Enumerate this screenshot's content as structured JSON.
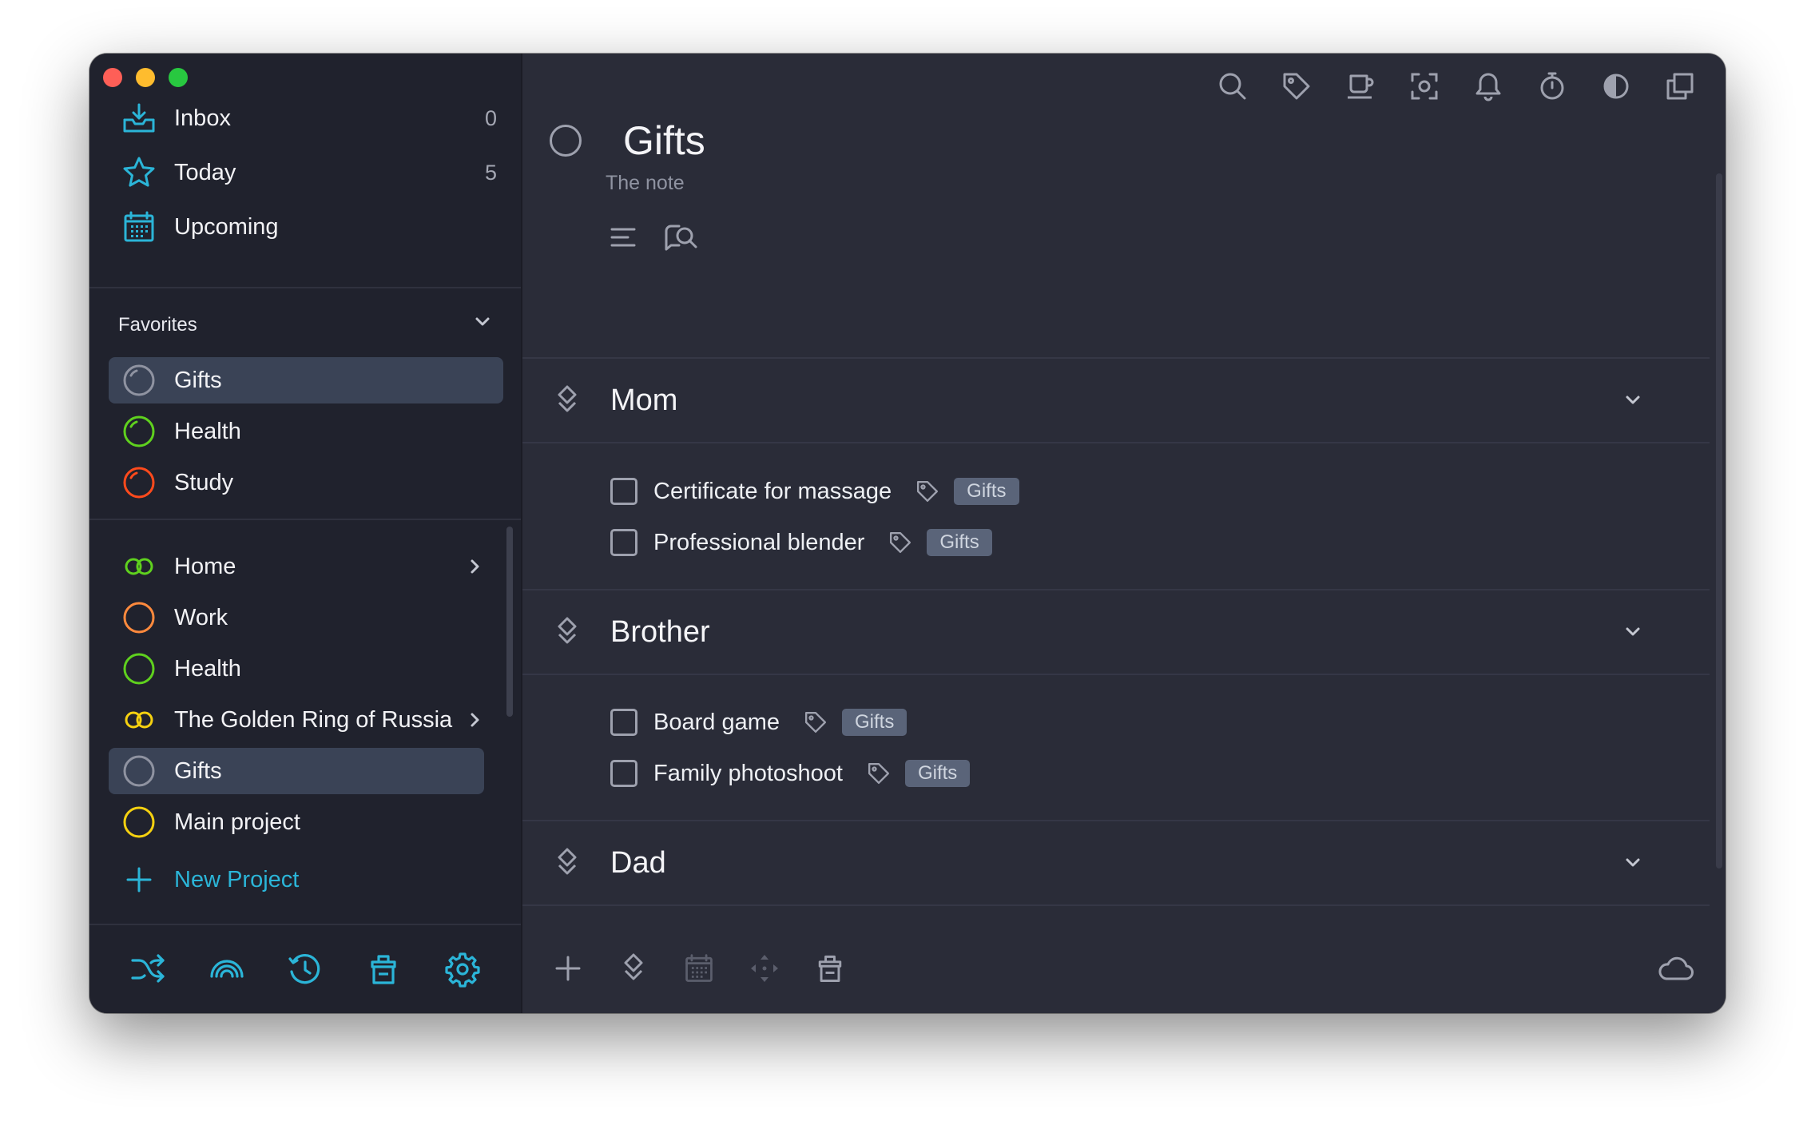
{
  "sidebar": {
    "nav": [
      {
        "label": "Inbox",
        "count": "0",
        "icon": "inbox-icon"
      },
      {
        "label": "Today",
        "count": "5",
        "icon": "star-icon"
      },
      {
        "label": "Upcoming",
        "count": "",
        "icon": "calendar-icon"
      }
    ],
    "favorites_label": "Favorites",
    "favorites": [
      {
        "label": "Gifts",
        "color": "#8f93a1"
      },
      {
        "label": "Health",
        "color": "#5fd11e"
      },
      {
        "label": "Study",
        "color": "#ff4a1c"
      }
    ],
    "projects": [
      {
        "label": "Home",
        "color": "#5fd11e",
        "icon": "double-ring-icon",
        "has_children": true
      },
      {
        "label": "Work",
        "color": "#ff8a3d",
        "icon": "ring-icon"
      },
      {
        "label": "Health",
        "color": "#5fd11e",
        "icon": "ring-icon"
      },
      {
        "label": "The Golden Ring of Russia",
        "color": "#f5d110",
        "icon": "double-ring-icon",
        "has_children": true
      },
      {
        "label": "Gifts",
        "color": "#8f93a1",
        "icon": "ring-icon"
      },
      {
        "label": "Main project",
        "color": "#f5d110",
        "icon": "ring-icon"
      }
    ],
    "new_project_label": "New Project",
    "accent": "#2bb5d8"
  },
  "main": {
    "title": "Gifts",
    "note": "The note",
    "sections": [
      {
        "title": "Mom",
        "tasks": [
          {
            "name": "Certificate for massage",
            "tag": "Gifts"
          },
          {
            "name": "Professional blender",
            "tag": "Gifts"
          }
        ]
      },
      {
        "title": "Brother",
        "tasks": [
          {
            "name": "Board game",
            "tag": "Gifts"
          },
          {
            "name": "Family photoshoot",
            "tag": "Gifts"
          }
        ]
      },
      {
        "title": "Dad",
        "tasks": []
      }
    ]
  }
}
